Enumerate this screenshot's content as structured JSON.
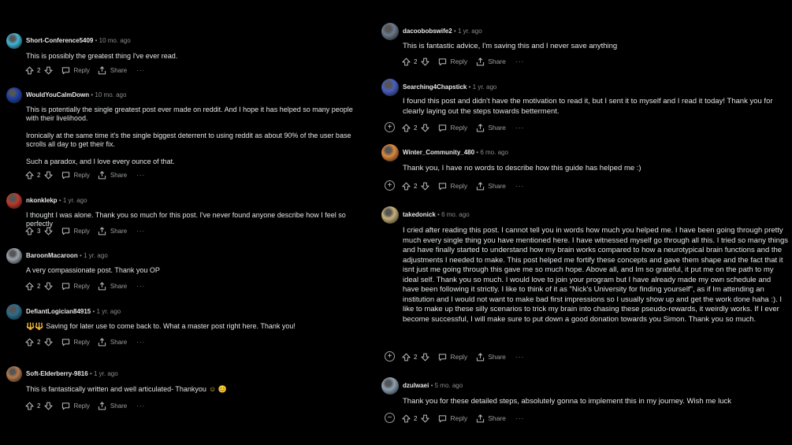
{
  "left": [
    {
      "user": "Short-Conference5409",
      "time": "10 mo. ago",
      "paras": [
        "This is possibly the greatest thing I've ever read."
      ],
      "votes": "2",
      "avatar_color": "#3fb6d8"
    },
    {
      "user": "WouldYouCalmDown",
      "time": "10 mo. ago",
      "paras": [
        "This is potentially the single greatest post ever made on reddit. And I hope it has helped so many people with their livelihood.",
        "Ironically at the same time it's the single biggest deterrent to using reddit as about 90% of the user base scrolls all day to get their fix.",
        "Such a paradox, and I love every ounce of that."
      ],
      "votes": "2",
      "avatar_color": "#1e3fa8"
    },
    {
      "user": "nkonklekp",
      "time": "1 yr. ago",
      "paras": [
        "I thought I was alone. Thank you so much for this post. I've never found anyone describe how I feel so perfectly"
      ],
      "votes": "3",
      "avatar_color": "#c0392b"
    },
    {
      "user": "BaroonMacaroon",
      "time": "1 yr. ago",
      "paras": [
        "A very compassionate post. Thank you OP"
      ],
      "votes": "2",
      "avatar_color": "#9aa3ad"
    },
    {
      "user": "DefiantLogician84915",
      "time": "1 yr. ago",
      "paras": [
        "Saving for later use to come back to. What a master post right here. Thank you!"
      ],
      "emoji_prefix": "🔱🔱",
      "votes": "2",
      "avatar_color": "#2a6f8f"
    },
    {
      "user": "Soft-Elderberry-9816",
      "time": "1 yr. ago",
      "paras": [
        "This is fantastically written and well articulated- Thankyou"
      ],
      "emoji_suffix": "☺ 😊",
      "votes": "2",
      "avatar_color": "#b87a4a"
    }
  ],
  "right": [
    {
      "user": "dacoobobswife2",
      "time": "1 yr. ago",
      "paras": [
        "This is fantastic advice, I'm saving this and I never save anything"
      ],
      "votes": "2",
      "avatar_color": "#6b7a8c",
      "expander": ""
    },
    {
      "user": "Searching4Chapstick",
      "time": "1 yr. ago",
      "paras": [
        "I found this post and didn't have the motivation to read it, but I sent it to myself and I read it today! Thank you for clearly laying out the steps towards betterment."
      ],
      "votes": "2",
      "avatar_color": "#4a5fc1",
      "expander": "+"
    },
    {
      "user": "Winter_Community_480",
      "time": "6 mo. ago",
      "paras": [
        "Thank you, I have no words to describe how this guide has helped me :)"
      ],
      "votes": "2",
      "avatar_color": "#e08a3c",
      "expander": "+"
    },
    {
      "user": "takedonick",
      "time": "6 mo. ago",
      "paras": [
        "I cried after reading this post. I cannot tell you in words how much you helped me. I have been going through pretty much every single thing you have mentioned here. I have witnessed myself go through all this. I tried so many things and have finally started to understand how my brain works compared to how a neurotypical brain functions and the adjustments I needed to make. This post helped me fortify these concepts and gave them shape and the fact that it isnt just me going through this gave me so much hope. Above all, and Im so grateful, it put me on the path to my ideal self. Thank you so much. I would love to join your program but I have already made my own schedule and have been following it strictly. I like to think of it as \"Nick's University for finding yourself\", as if Im attending an institution and I would not want to make bad first impressions so I usually show up and get the work done haha :). I like to make up these silly scenarios to trick my brain into chasing these pseudo-rewards, it weirdly works. If I ever become successful, I will make sure to put down a good donation towards you Simon. Thank you so much."
      ],
      "votes": "2",
      "avatar_color": "#c9b27a",
      "expander": "+"
    },
    {
      "user": "dzulwaei",
      "time": "5 mo. ago",
      "paras": [
        "Thank you for these detailed steps, absolutely gonna to implement this in my journey. Wish me luck"
      ],
      "votes": "2",
      "avatar_color": "#8fa1b3",
      "expander": "−"
    }
  ],
  "labels": {
    "reply": "Reply",
    "share": "Share",
    "more": "···",
    "sep": "•"
  },
  "icons": {
    "upvote": "upvote-icon",
    "downvote": "downvote-icon",
    "reply": "reply-icon",
    "share": "share-icon"
  }
}
